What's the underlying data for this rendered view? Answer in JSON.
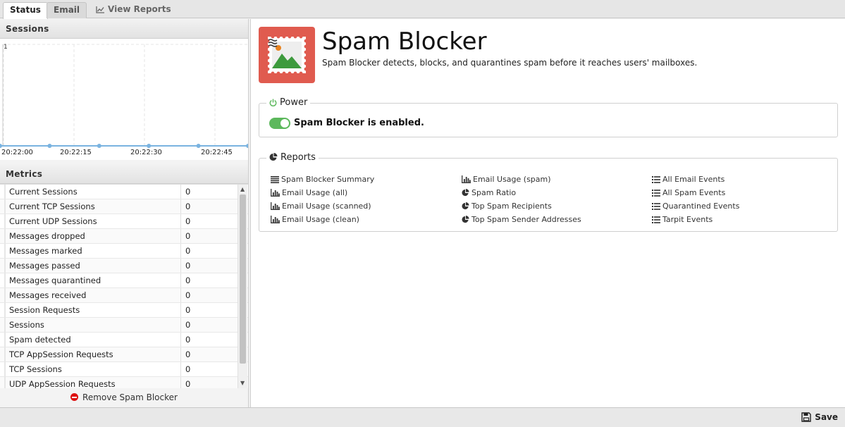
{
  "tabs": [
    {
      "label": "Status",
      "active": true
    },
    {
      "label": "Email",
      "active": false
    },
    {
      "label": "View Reports",
      "active": false,
      "icon": "line-chart-icon"
    }
  ],
  "sessions": {
    "title": "Sessions",
    "chart_data": {
      "type": "line",
      "y_tick": "1",
      "x_ticks": [
        "20:22:00",
        "20:22:15",
        "20:22:30",
        "20:22:45"
      ],
      "series": [
        {
          "values": [
            0,
            0,
            0,
            0,
            0,
            0
          ]
        }
      ],
      "ylim": [
        0,
        1
      ],
      "grid": true
    }
  },
  "metrics": {
    "title": "Metrics",
    "rows": [
      {
        "name": "Current Sessions",
        "value": "0"
      },
      {
        "name": "Current TCP Sessions",
        "value": "0"
      },
      {
        "name": "Current UDP Sessions",
        "value": "0"
      },
      {
        "name": "Messages dropped",
        "value": "0"
      },
      {
        "name": "Messages marked",
        "value": "0"
      },
      {
        "name": "Messages passed",
        "value": "0"
      },
      {
        "name": "Messages quarantined",
        "value": "0"
      },
      {
        "name": "Messages received",
        "value": "0"
      },
      {
        "name": "Session Requests",
        "value": "0"
      },
      {
        "name": "Sessions",
        "value": "0"
      },
      {
        "name": "Spam detected",
        "value": "0"
      },
      {
        "name": "TCP AppSession Requests",
        "value": "0"
      },
      {
        "name": "TCP Sessions",
        "value": "0"
      },
      {
        "name": "UDP AppSession Requests",
        "value": "0"
      }
    ],
    "remove_label": "Remove Spam Blocker"
  },
  "app": {
    "title": "Spam Blocker",
    "description": "Spam Blocker detects, blocks, and quarantines spam before it reaches users' mailboxes.",
    "icon": "stamp-icon",
    "icon_color": "#e05b4f"
  },
  "power": {
    "legend": "Power",
    "status_text": "Spam Blocker is enabled.",
    "enabled": true,
    "accent": "#5cb85c"
  },
  "reports": {
    "legend": "Reports",
    "columns": [
      [
        {
          "label": "Spam Blocker Summary",
          "icon": "text-lines-icon"
        },
        {
          "label": "Email Usage (all)",
          "icon": "bar-chart-icon"
        },
        {
          "label": "Email Usage (scanned)",
          "icon": "bar-chart-icon"
        },
        {
          "label": "Email Usage (clean)",
          "icon": "bar-chart-icon"
        }
      ],
      [
        {
          "label": "Email Usage (spam)",
          "icon": "bar-chart-icon"
        },
        {
          "label": "Spam Ratio",
          "icon": "pie-chart-icon"
        },
        {
          "label": "Top Spam Recipients",
          "icon": "pie-chart-icon"
        },
        {
          "label": "Top Spam Sender Addresses",
          "icon": "pie-chart-icon"
        }
      ],
      [
        {
          "label": "All Email Events",
          "icon": "list-icon"
        },
        {
          "label": "All Spam Events",
          "icon": "list-icon"
        },
        {
          "label": "Quarantined Events",
          "icon": "list-icon"
        },
        {
          "label": "Tarpit Events",
          "icon": "list-icon"
        }
      ]
    ]
  },
  "toolbar": {
    "save_label": "Save"
  }
}
